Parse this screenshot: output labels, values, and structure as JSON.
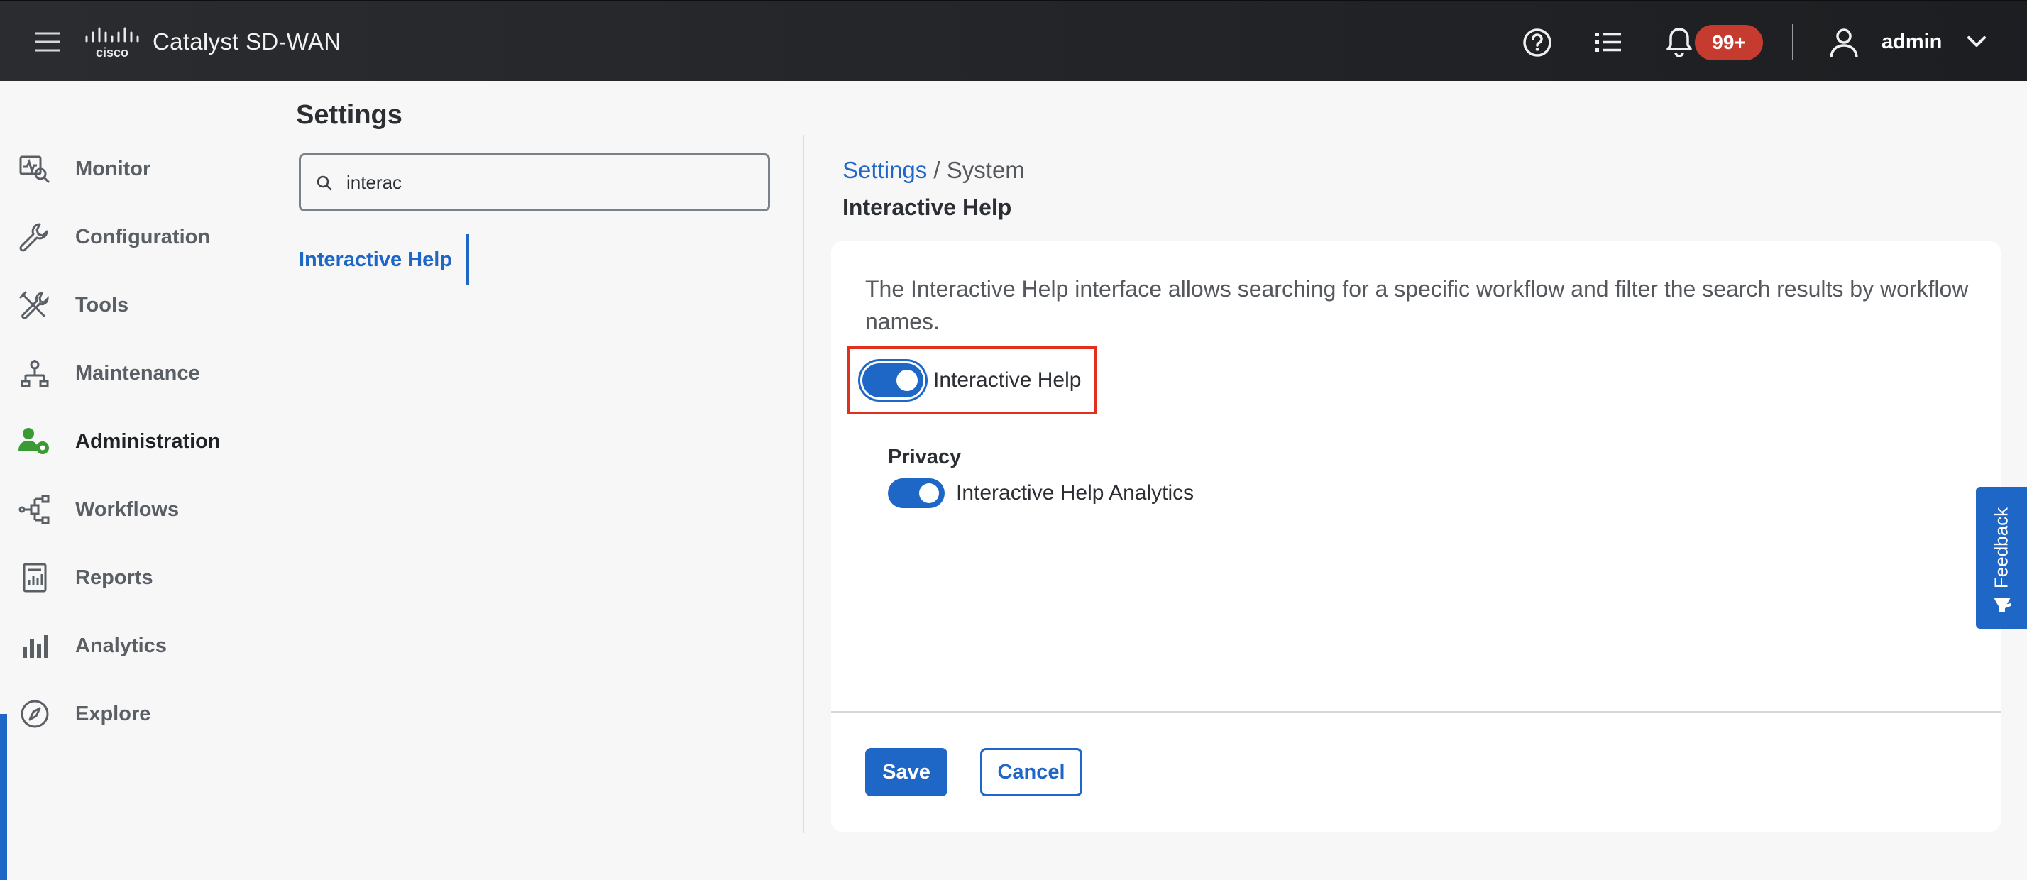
{
  "header": {
    "brand": "cisco",
    "app_title": "Catalyst SD-WAN",
    "notification_count": "99+",
    "username": "admin",
    "icons": [
      "menu-icon",
      "cisco-logo",
      "help-icon",
      "tasks-list-icon",
      "bell-icon",
      "user-icon",
      "chevron-down-icon"
    ]
  },
  "nav": {
    "items": [
      {
        "label": "Monitor",
        "icon": "monitor-icon"
      },
      {
        "label": "Configuration",
        "icon": "wrench-icon"
      },
      {
        "label": "Tools",
        "icon": "tools-icon"
      },
      {
        "label": "Maintenance",
        "icon": "maintenance-icon"
      },
      {
        "label": "Administration",
        "icon": "admin-users-icon",
        "active": true
      },
      {
        "label": "Workflows",
        "icon": "workflows-icon"
      },
      {
        "label": "Reports",
        "icon": "reports-icon"
      },
      {
        "label": "Analytics",
        "icon": "analytics-icon"
      },
      {
        "label": "Explore",
        "icon": "compass-icon"
      }
    ]
  },
  "settings": {
    "title": "Settings",
    "search": {
      "value": "interac"
    },
    "results": [
      "Interactive Help"
    ]
  },
  "content": {
    "breadcrumb": {
      "parent": "Settings",
      "separator": " / ",
      "current": "System"
    },
    "title": "Interactive Help",
    "description": "The Interactive Help interface allows searching for a specific workflow and filter the search results by workflow names.",
    "main_toggle": {
      "label": "Interactive Help",
      "enabled": true
    },
    "privacy": {
      "title": "Privacy",
      "toggle": {
        "label": "Interactive Help Analytics",
        "enabled": true
      }
    },
    "buttons": {
      "save": "Save",
      "cancel": "Cancel"
    }
  },
  "feedback": {
    "label": "Feedback"
  },
  "colors": {
    "accent": "#1f67c7",
    "badge": "#c63b2f",
    "highlight": "#e0301e",
    "topbar": "#1f2125",
    "admin_icon": "#3a9b35"
  }
}
